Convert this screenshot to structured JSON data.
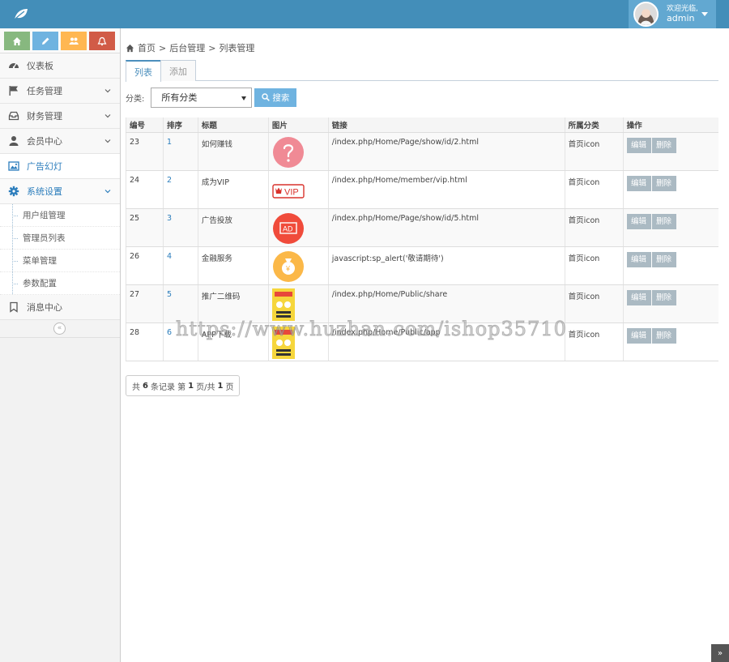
{
  "navbar": {
    "brand_icon": "leaf-icon",
    "user": {
      "welcome": "欢迎光临,",
      "name": "admin"
    }
  },
  "sidebar": {
    "shortcuts": [
      {
        "icon": "home-icon",
        "color": "#87b87f"
      },
      {
        "icon": "pencil-icon",
        "color": "#6fb3e0"
      },
      {
        "icon": "users-icon",
        "color": "#ffb752"
      },
      {
        "icon": "bell-icon",
        "color": "#d15b47"
      }
    ],
    "items": [
      {
        "label": "仪表板",
        "icon": "dashboard-icon"
      },
      {
        "label": "任务管理",
        "icon": "flag-icon"
      },
      {
        "label": "财务管理",
        "icon": "inbox-icon"
      },
      {
        "label": "会员中心",
        "icon": "user-icon"
      },
      {
        "label": "广告幻灯",
        "icon": "picture-icon"
      },
      {
        "label": "系统设置",
        "icon": "gear-icon"
      },
      {
        "label": "消息中心",
        "icon": "bookmark-icon"
      }
    ],
    "submenu": [
      "用户组管理",
      "管理员列表",
      "菜单管理",
      "参数配置"
    ]
  },
  "breadcrumb": {
    "home": "首页",
    "sep": ">",
    "level2": "后台管理",
    "level3": "列表管理"
  },
  "tabs": {
    "list": "列表",
    "add": "添加"
  },
  "filter": {
    "label": "分类:",
    "selected": "所有分类",
    "search": "搜索"
  },
  "table": {
    "headers": [
      "编号",
      "排序",
      "标题",
      "图片",
      "链接",
      "所属分类",
      "操作"
    ],
    "rows": [
      {
        "id": "23",
        "sort": "1",
        "title": "如何赚钱",
        "pic": "question-icon",
        "link": "/index.php/Home/Page/show/id/2.html",
        "category": "首页icon"
      },
      {
        "id": "24",
        "sort": "2",
        "title": "成为VIP",
        "pic": "vip-icon",
        "link": "/index.php/Home/member/vip.html",
        "category": "首页icon"
      },
      {
        "id": "25",
        "sort": "3",
        "title": "广告投放",
        "pic": "ad-icon",
        "link": "/index.php/Home/Page/show/id/5.html",
        "category": "首页icon"
      },
      {
        "id": "26",
        "sort": "4",
        "title": "金融服务",
        "pic": "money-bag-icon",
        "link": "javascript:sp_alert('敬请期待')",
        "category": "首页icon"
      },
      {
        "id": "27",
        "sort": "5",
        "title": "推广二维码",
        "pic": "qr-poster-image",
        "link": "/index.php/Home/Public/share",
        "category": "首页icon"
      },
      {
        "id": "28",
        "sort": "6",
        "title": "APP下载",
        "pic": "app-poster-image",
        "link": "/index.php/Home/Public/app",
        "category": "首页icon"
      }
    ],
    "edit_label": "编辑",
    "delete_label": "删除"
  },
  "pager": {
    "prefix": "共",
    "total": "6",
    "mid": "条记录 第",
    "page": "1",
    "mid2": "页/共",
    "pages": "1",
    "suffix": "页"
  },
  "watermark": "https://www.huzhan.com/ishop35710",
  "to_top": "»"
}
